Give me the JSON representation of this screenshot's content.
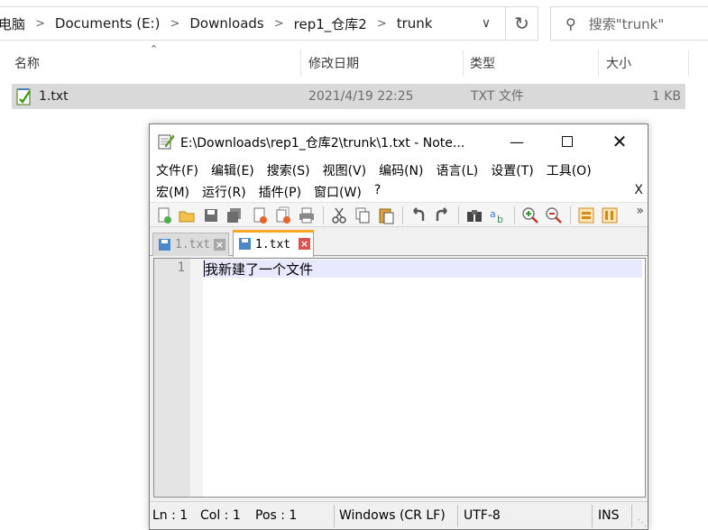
{
  "explorer": {
    "breadcrumb": [
      "电脑",
      "Documents (E:)",
      "Downloads",
      "rep1_仓库2",
      "trunk"
    ],
    "search_placeholder": "搜索\"trunk\"",
    "columns": {
      "name": "名称",
      "modified": "修改日期",
      "type": "类型",
      "size": "大小"
    },
    "file": {
      "name": "1.txt",
      "modified": "2021/4/19 22:25",
      "type": "TXT 文件",
      "size": "1 KB"
    }
  },
  "notepad": {
    "title": "E:\\Downloads\\rep1_仓库2\\trunk\\1.txt - Note...",
    "menu_row1": [
      "文件(F)",
      "编辑(E)",
      "搜索(S)",
      "视图(V)",
      "编码(N)",
      "语言(L)",
      "设置(T)",
      "工具(O)"
    ],
    "menu_row2": [
      "宏(M)",
      "运行(R)",
      "插件(P)",
      "窗口(W)",
      "?"
    ],
    "menu_close": "X",
    "tabs": [
      {
        "label": "1.txt",
        "active": false
      },
      {
        "label": "1.txt",
        "active": true
      }
    ],
    "editor": {
      "line_number": "1",
      "line_text": "我新建了一个文件"
    },
    "status": {
      "line": "Ln : 1",
      "col": "Col : 1",
      "pos": "Pos : 1",
      "eol": "Windows (CR LF)",
      "encoding": "UTF-8",
      "mode": "INS"
    }
  },
  "colors": {
    "tab_accent": "#f6a623",
    "current_line": "#e8e8ff",
    "selected_row": "#d9d9d9"
  }
}
